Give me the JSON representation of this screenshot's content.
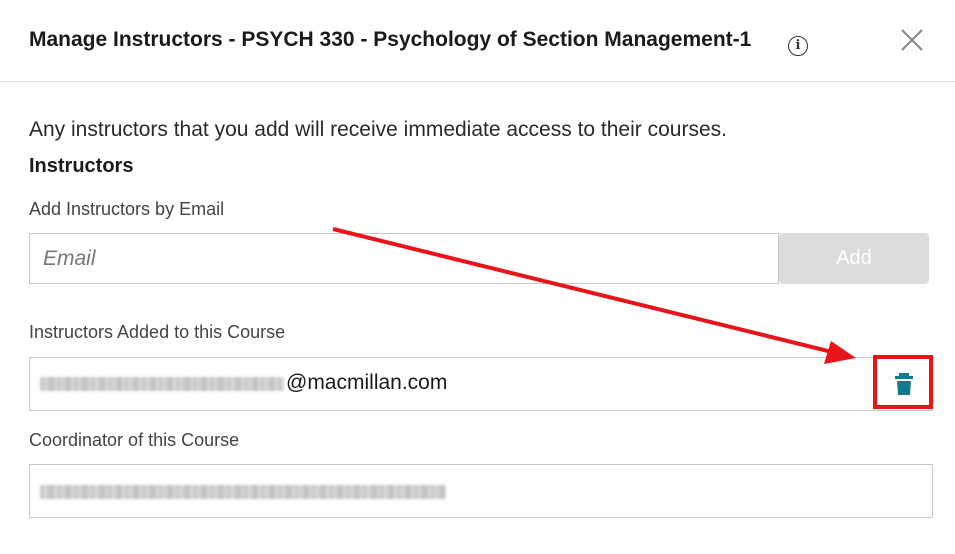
{
  "dialog": {
    "title": "Manage Instructors - PSYCH 330 - Psychology of Section Management-1",
    "info_icon": "info-icon",
    "info_glyph": "i",
    "close_icon": "close-icon"
  },
  "intro_text": "Any instructors that you add will receive immediate access to their courses.",
  "instructors_section": {
    "heading": "Instructors",
    "add_label": "Add Instructors by Email",
    "email_placeholder": "Email",
    "email_value": "",
    "add_button_label": "Add",
    "added_label": "Instructors Added to this Course",
    "instructors": [
      {
        "email_visible_domain": "@macmillan.com",
        "delete_icon": "trash-icon"
      }
    ]
  },
  "coordinator_section": {
    "label": "Coordinator of this Course"
  },
  "annotation": {
    "arrow_color": "#e8141a",
    "highlight_color": "#e8141a"
  },
  "colors": {
    "accent": "#137b8a",
    "button_disabled": "#dcdcdc",
    "border": "#c8c8c8"
  }
}
